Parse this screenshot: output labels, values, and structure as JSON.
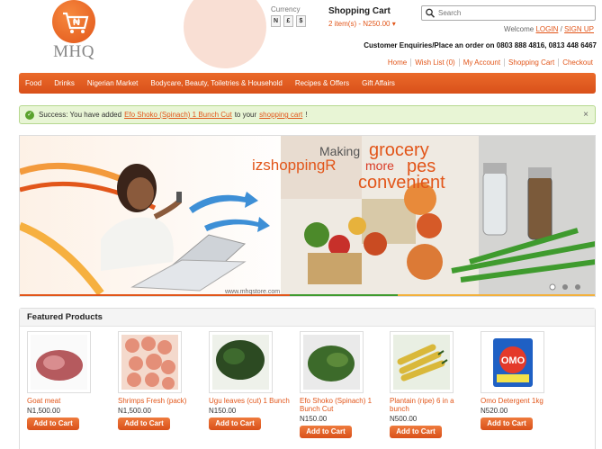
{
  "header": {
    "logo_text": "MHQ",
    "currency_label": "Currency",
    "currencies": [
      "N",
      "£",
      "$"
    ],
    "cart_title": "Shopping Cart",
    "cart_items": "2 item(s) - N250.00",
    "search_placeholder": "Search",
    "welcome_prefix": "Welcome",
    "login": "LOGIN",
    "separator": "/",
    "signup": "SIGN UP",
    "enquiry": "Customer Enquiries/Place an order on 0803 888 4816, 0813 448 6467",
    "top_links": [
      "Home",
      "Wish List (0)",
      "My Account",
      "Shopping Cart",
      "Checkout"
    ]
  },
  "nav": {
    "items": [
      "Food",
      "Drinks",
      "Nigerian Market",
      "Bodycare, Beauty, Toiletries & Household",
      "Recipes & Offers",
      "Gift Affairs"
    ]
  },
  "alert": {
    "prefix": "Success: You have added",
    "product": "Efo Shoko (Spinach) 1 Bunch Cut",
    "middle": "to your",
    "cart": "shopping cart",
    "suffix": "!",
    "close": "×"
  },
  "banner": {
    "text_making": "Making",
    "text_grocery": "grocery",
    "text_shopping": "izshoppingR",
    "text_more": "more",
    "text_recipes": "pes",
    "text_convenient": "convenient",
    "text_url": "www.mhqstore.com"
  },
  "featured": {
    "title": "Featured Products",
    "add_label": "Add to Cart",
    "products": [
      {
        "name": "Goat meat",
        "price": "N1,500.00"
      },
      {
        "name": "Shrimps Fresh (pack)",
        "price": "N1,500.00"
      },
      {
        "name": "Ugu leaves (cut) 1 Bunch",
        "price": "N150.00"
      },
      {
        "name": "Efo Shoko (Spinach) 1 Bunch Cut",
        "price": "N150.00"
      },
      {
        "name": "Plantain (ripe) 6 in a bunch",
        "price": "N500.00"
      },
      {
        "name": "Omo Detergent 1kg",
        "price": "N520.00"
      }
    ]
  },
  "colors": {
    "accent": "#e2561a",
    "success": "#5aa22d"
  }
}
